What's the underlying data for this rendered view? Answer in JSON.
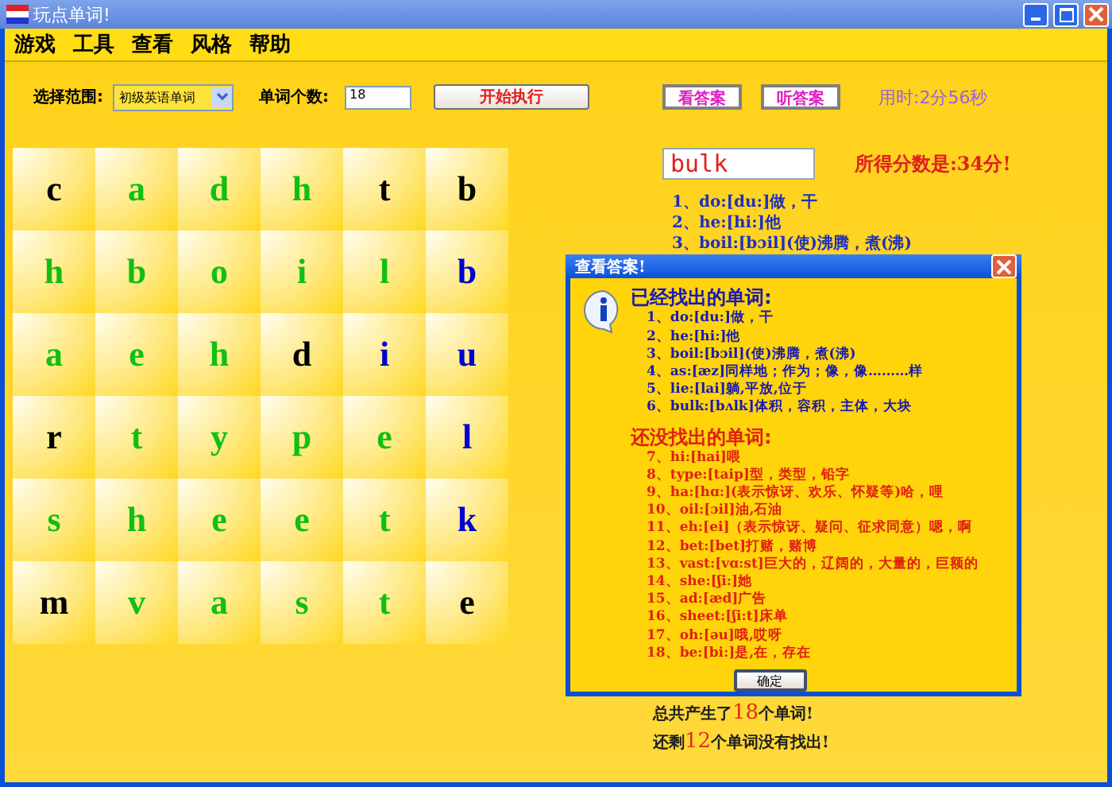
{
  "window": {
    "title": "玩点单词!"
  },
  "menu": [
    "游戏",
    "工具",
    "查看",
    "风格",
    "帮助"
  ],
  "toolbar": {
    "range_label": "选择范围:",
    "range_value": "初级英语单词",
    "count_label": "单词个数:",
    "count_value": "18",
    "start_button": "开始执行",
    "answer_button": "看答案",
    "listen_button": "听答案",
    "time": "用时:2分56秒"
  },
  "grid": [
    [
      {
        "letter": "c",
        "color": "#000000"
      },
      {
        "letter": "a",
        "color": "#10c010"
      },
      {
        "letter": "d",
        "color": "#10c010"
      },
      {
        "letter": "h",
        "color": "#10c010"
      },
      {
        "letter": "t",
        "color": "#000000"
      },
      {
        "letter": "b",
        "color": "#000000"
      }
    ],
    [
      {
        "letter": "h",
        "color": "#10c010"
      },
      {
        "letter": "b",
        "color": "#10c010"
      },
      {
        "letter": "o",
        "color": "#10c010"
      },
      {
        "letter": "i",
        "color": "#10c010"
      },
      {
        "letter": "l",
        "color": "#10c010"
      },
      {
        "letter": "b",
        "color": "#0000d0"
      }
    ],
    [
      {
        "letter": "a",
        "color": "#10c010"
      },
      {
        "letter": "e",
        "color": "#10c010"
      },
      {
        "letter": "h",
        "color": "#10c010"
      },
      {
        "letter": "d",
        "color": "#000000"
      },
      {
        "letter": "i",
        "color": "#0000d0"
      },
      {
        "letter": "u",
        "color": "#0000d0"
      }
    ],
    [
      {
        "letter": "r",
        "color": "#000000"
      },
      {
        "letter": "t",
        "color": "#10c010"
      },
      {
        "letter": "y",
        "color": "#10c010"
      },
      {
        "letter": "p",
        "color": "#10c010"
      },
      {
        "letter": "e",
        "color": "#10c010"
      },
      {
        "letter": "l",
        "color": "#0000d0"
      }
    ],
    [
      {
        "letter": "s",
        "color": "#10c010"
      },
      {
        "letter": "h",
        "color": "#10c010"
      },
      {
        "letter": "e",
        "color": "#10c010"
      },
      {
        "letter": "e",
        "color": "#10c010"
      },
      {
        "letter": "t",
        "color": "#10c010"
      },
      {
        "letter": "k",
        "color": "#0000d0"
      }
    ],
    [
      {
        "letter": "m",
        "color": "#000000"
      },
      {
        "letter": "v",
        "color": "#10c010"
      },
      {
        "letter": "a",
        "color": "#10c010"
      },
      {
        "letter": "s",
        "color": "#10c010"
      },
      {
        "letter": "t",
        "color": "#10c010"
      },
      {
        "letter": "e",
        "color": "#000000"
      }
    ]
  ],
  "word_input": {
    "value": "bulk"
  },
  "score": "所得分数是:34分!",
  "found_list": [
    "1、do:[du:]做，干",
    "2、he:[hi:]他",
    "3、boil:[bɔil](使)沸腾，煮(沸)"
  ],
  "summary": [
    {
      "prefix": "总共产生了",
      "count": "18",
      "suffix": "个单词!"
    },
    {
      "prefix": "还剩",
      "count": "12",
      "suffix": "个单词没有找出!"
    }
  ],
  "dialog": {
    "title": "查看答案!",
    "found_heading": "已经找出的单词:",
    "found": [
      "1、do:[du:]做，干",
      "2、he:[hi:]他",
      "3、boil:[bɔil](使)沸腾，煮(沸)",
      "4、as:[æz]同样地；作为；像，像………样",
      "5、lie:[lai]躺,平放,位于",
      "6、bulk:[bʌlk]体积，容积，主体，大块"
    ],
    "missing_heading": "还没找出的单词:",
    "missing": [
      "7、hi:[hai]喂",
      "8、type:[taip]型，类型，铅字",
      "9、ha:[hɑ:](表示惊讶、欢乐、怀疑等)哈，哩",
      "10、oil:[ɔil]油,石油",
      "11、eh:[ei]（表示惊讶、疑问、征求同意）嗯，啊",
      "12、bet:[bet]打赌，赌博",
      "13、vast:[vɑ:st]巨大的，辽阔的，大量的，巨额的",
      "14、she:[ʃi:]她",
      "15、ad:[æd]广告",
      "16、sheet:[ʃi:t]床单",
      "17、oh:[əu]哦,哎呀",
      "18、be:[bi:]是,在，存在"
    ],
    "ok_button": "确定"
  }
}
